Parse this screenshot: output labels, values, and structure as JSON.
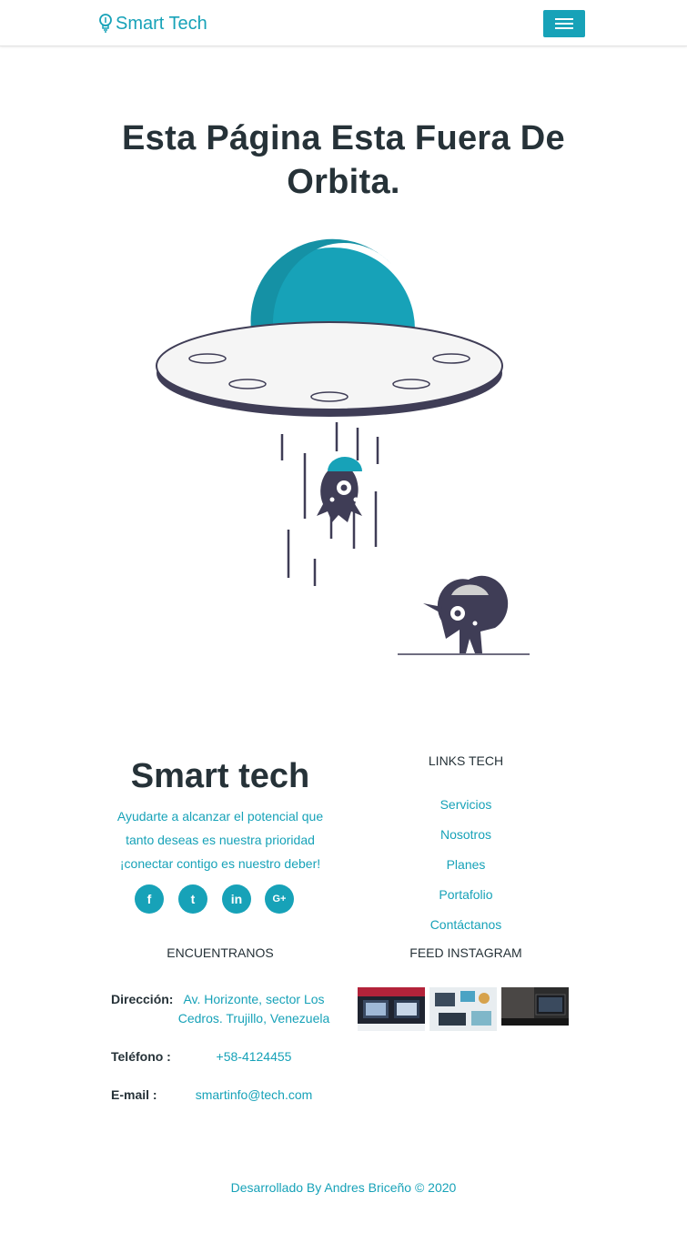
{
  "navbar": {
    "brand": "Smart Tech",
    "toggle_icon": "hamburger-icon"
  },
  "main": {
    "title": "Esta Página Esta Fuera De Orbita."
  },
  "footer": {
    "brand": "Smart tech",
    "description": "Ayudarte a alcanzar el potencial que tanto deseas es nuestra prioridad ¡conectar contigo es nuestro deber!",
    "social": [
      {
        "name": "facebook-icon",
        "glyph": "f"
      },
      {
        "name": "twitter-icon",
        "glyph": "t"
      },
      {
        "name": "linkedin-icon",
        "glyph": "in"
      },
      {
        "name": "google-plus-icon",
        "glyph": "G+"
      }
    ],
    "links_title": "LINKS TECH",
    "links": [
      "Servicios",
      "Nosotros",
      "Planes",
      "Portafolio",
      "Contáctanos"
    ],
    "contact_title": "ENCUENTRANOS",
    "address_label": "Dirección:",
    "address": "Av. Horizonte, sector Los Cedros. Trujillo, Venezuela",
    "phone_label": "Teléfono :",
    "phone": "+58-4124455",
    "email_label": "E-mail :",
    "email": "smartinfo@tech.com",
    "instagram_title": "FEED INSTAGRAM",
    "credit": "Desarrollado By Andres Briceño © 2020"
  },
  "colors": {
    "accent": "#17a2b8",
    "dark": "#263238",
    "ufo_dark": "#3f3d56"
  }
}
